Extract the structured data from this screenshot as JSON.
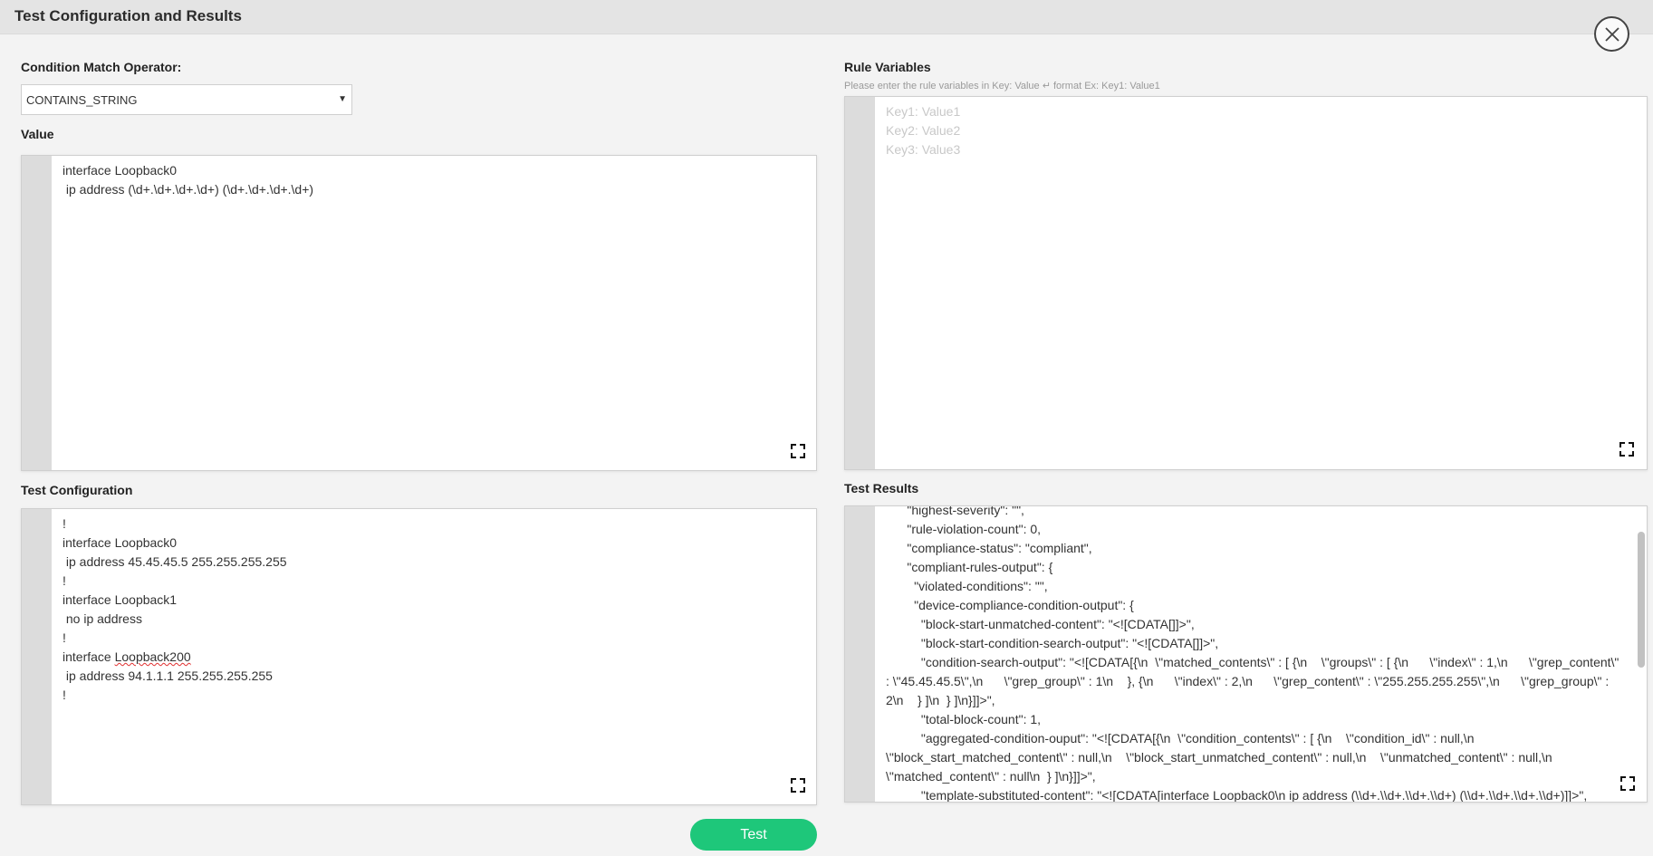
{
  "dialog": {
    "title": "Test Configuration and Results"
  },
  "condition_match": {
    "label": "Condition Match Operator:",
    "selected": "CONTAINS_STRING"
  },
  "value": {
    "label": "Value",
    "lines": [
      "interface Loopback0",
      " ip address (\\d+.\\d+.\\d+.\\d+) (\\d+.\\d+.\\d+.\\d+)"
    ]
  },
  "rule_variables": {
    "label": "Rule Variables",
    "hint": "Please enter the rule variables in Key: Value ↵ format Ex: Key1: Value1",
    "placeholder_lines": [
      "Key1: Value1",
      "Key2: Value2",
      "Key3: Value3"
    ]
  },
  "test_configuration": {
    "label": "Test Configuration",
    "lines": [
      "!",
      "interface Loopback0",
      " ip address 45.45.45.5 255.255.255.255",
      "!",
      "interface Loopback1",
      " no ip address",
      "!",
      "interface Loopback200",
      " ip address 94.1.1.1 255.255.255.255",
      "!"
    ]
  },
  "test_results": {
    "label": "Test Results",
    "text": "      \"highest-severity\": \"\",\n      \"rule-violation-count\": 0,\n      \"compliance-status\": \"compliant\",\n      \"compliant-rules-output\": {\n        \"violated-conditions\": \"\",\n        \"device-compliance-condition-output\": {\n          \"block-start-unmatched-content\": \"<![CDATA[]]>\",\n          \"block-start-condition-search-output\": \"<![CDATA[]]>\",\n          \"condition-search-output\": \"<![CDATA[{\\n  \\\"matched_contents\\\" : [ {\\n    \\\"groups\\\" : [ {\\n      \\\"index\\\" : 1,\\n      \\\"grep_content\\\" : \\\"45.45.45.5\\\",\\n      \\\"grep_group\\\" : 1\\n    }, {\\n      \\\"index\\\" : 2,\\n      \\\"grep_content\\\" : \\\"255.255.255.255\\\",\\n      \\\"grep_group\\\" : 2\\n    } ]\\n  } ]\\n}]]>\",\n          \"total-block-count\": 1,\n          \"aggregated-condition-ouput\": \"<![CDATA[{\\n  \\\"condition_contents\\\" : [ {\\n    \\\"condition_id\\\" : null,\\n    \\\"block_start_matched_content\\\" : null,\\n    \\\"block_start_unmatched_content\\\" : null,\\n    \\\"unmatched_content\\\" : null,\\n    \\\"matched_content\\\" : null\\n  } ]\\n}]]>\",\n          \"template-substituted-content\": \"<![CDATA[interface Loopback0\\n ip address (\\\\d+.\\\\d+.\\\\d+.\\\\d+) (\\\\d+.\\\\d+.\\\\d+.\\\\d+)]]>\","
  },
  "actions": {
    "test_label": "Test"
  },
  "icons": {
    "close": "close-icon",
    "expand": "expand-icon"
  }
}
